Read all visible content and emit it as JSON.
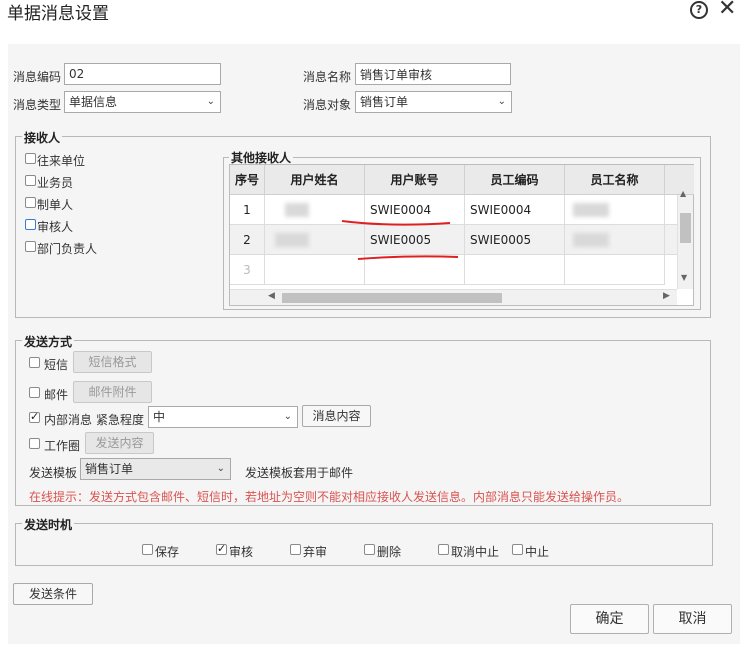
{
  "window": {
    "title": "单据消息设置"
  },
  "form": {
    "code_label": "消息编码",
    "code_value": "02",
    "name_label": "消息名称",
    "name_value": "销售订单审核",
    "type_label": "消息类型",
    "type_value": "单据信息",
    "target_label": "消息对象",
    "target_value": "销售订单"
  },
  "receivers": {
    "legend": "接收人",
    "options": [
      {
        "label": "往来单位",
        "checked": false
      },
      {
        "label": "业务员",
        "checked": false
      },
      {
        "label": "制单人",
        "checked": false
      },
      {
        "label": "审核人",
        "checked": false
      },
      {
        "label": "部门负责人",
        "checked": false
      }
    ],
    "other_legend": "其他接收人",
    "columns": [
      "序号",
      "用户姓名",
      "用户账号",
      "员工编码",
      "员工名称"
    ],
    "rows": [
      {
        "no": "1",
        "account": "SWIE0004",
        "emp_code": "SWIE0004"
      },
      {
        "no": "2",
        "account": "SWIE0005",
        "emp_code": "SWIE0005"
      },
      {
        "no": "3",
        "account": "",
        "emp_code": ""
      }
    ]
  },
  "send_method": {
    "legend": "发送方式",
    "sms_label": "短信",
    "sms_btn": "短信格式",
    "mail_label": "邮件",
    "mail_btn": "邮件附件",
    "internal_label": "内部消息",
    "urgency_label": "紧急程度",
    "urgency_value": "中",
    "internal_btn": "消息内容",
    "work_label": "工作圈",
    "work_btn": "发送内容",
    "template_label": "发送模板",
    "template_value": "销售订单",
    "template_note": "发送模板套用于邮件",
    "hint": "在线提示：发送方式包含邮件、短信时，若地址为空则不能对相应接收人发送信息。内部消息只能发送给操作员。",
    "hint_color": "#d9534f"
  },
  "send_timing": {
    "legend": "发送时机",
    "options": [
      {
        "label": "保存",
        "checked": false
      },
      {
        "label": "审核",
        "checked": true
      },
      {
        "label": "弃审",
        "checked": false
      },
      {
        "label": "删除",
        "checked": false
      },
      {
        "label": "取消中止",
        "checked": false
      },
      {
        "label": "中止",
        "checked": false
      }
    ]
  },
  "footer": {
    "condition_btn": "发送条件",
    "ok_btn": "确定",
    "cancel_btn": "取消"
  },
  "annotation_color": "#e02020"
}
